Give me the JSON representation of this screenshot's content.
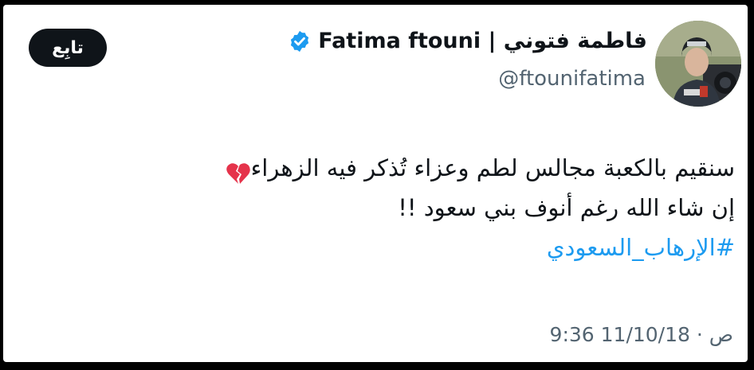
{
  "profile": {
    "display_name": "Fatima ftouni | فاطمة فتوني",
    "handle": "@ftounifatima",
    "verified_icon": "verified-badge-icon",
    "avatar_icon": "profile-photo"
  },
  "follow_button": {
    "label": "تابِع"
  },
  "tweet": {
    "line1": "سنقيم بالكعبة مجالس لطم وعزاء تُذكر فيه الزهراء",
    "line1_emoji": "broken-heart-icon",
    "line2": "إن شاء الله رغم أنوف بني سعود !!",
    "hashtag": "#الإرهاب_السعودي"
  },
  "timestamp": "9:36 ص · 11/10/18",
  "colors": {
    "text": "#0f1419",
    "secondary": "#536471",
    "link": "#1d9bf0",
    "verified": "#1d9bf0",
    "button_bg": "#0f1419",
    "heart": "#e5334b"
  }
}
